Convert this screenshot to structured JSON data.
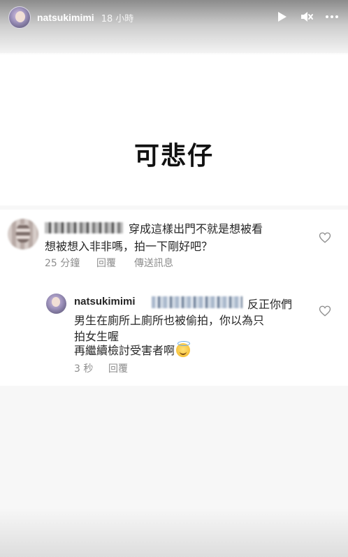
{
  "header": {
    "username": "natsukimimi",
    "time": "18 小時",
    "icons": [
      "play-icon",
      "mute-icon",
      "more-icon"
    ]
  },
  "story": {
    "title": "可悲仔"
  },
  "comment": {
    "text_line1": "穿成這樣出門不就是想被看",
    "text_line2": "想被想入非非嗎，拍一下剛好吧？",
    "time": "25 分鐘",
    "reply_label": "回覆",
    "send_label": "傳送訊息"
  },
  "reply": {
    "username": "natsukimimi",
    "line1": "反正你們",
    "line2": "男生在廁所上廁所也被偷拍，你以為只",
    "line3": "拍女生喔",
    "line4": "再繼續檢討受害者啊",
    "time": "3 秒",
    "reply_label": "回覆"
  },
  "colors": {
    "text": "#262626",
    "meta": "#8e8e8e",
    "panel": "#ffffff",
    "background": "#f7f7f7"
  }
}
